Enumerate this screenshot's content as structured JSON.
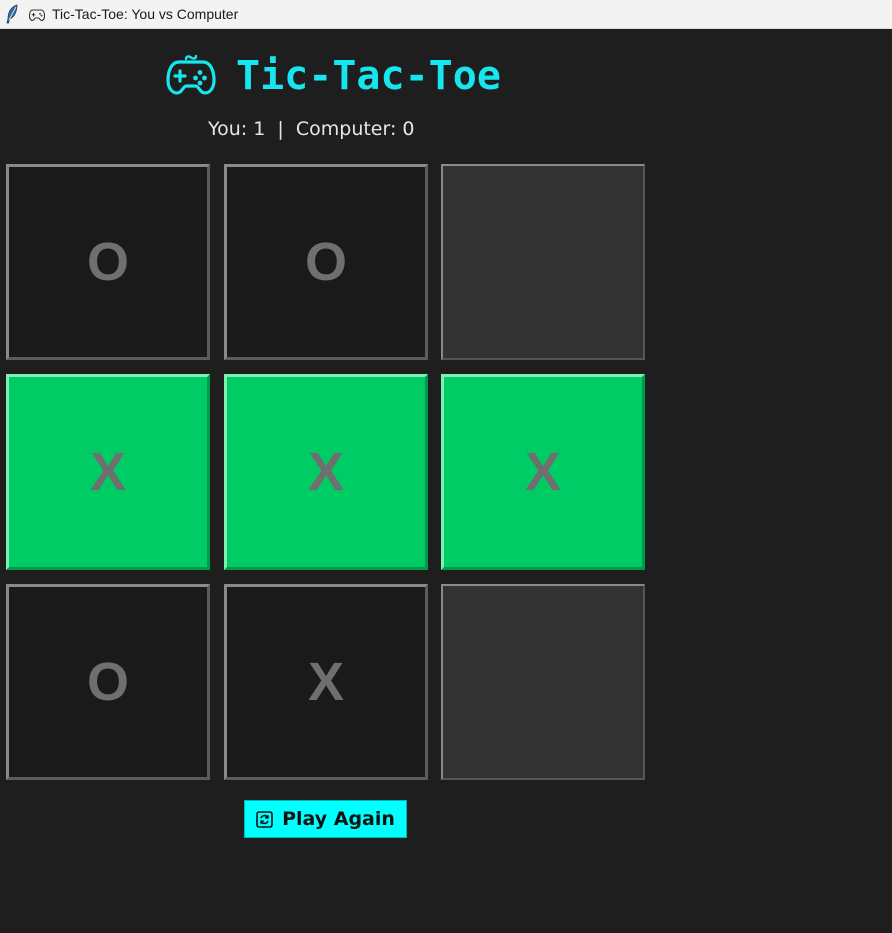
{
  "window": {
    "title": "Tic-Tac-Toe: You vs Computer"
  },
  "header": {
    "title": "Tic-Tac-Toe",
    "title_color": "#17e6ee",
    "icon": "gamepad-icon"
  },
  "score": {
    "you_label": "You: ",
    "you_value": "1",
    "separator": "  |  ",
    "computer_label": "Computer: ",
    "computer_value": "0"
  },
  "board": {
    "cells": [
      {
        "mark": "O",
        "state": "played"
      },
      {
        "mark": "O",
        "state": "played"
      },
      {
        "mark": "",
        "state": "empty"
      },
      {
        "mark": "X",
        "state": "win"
      },
      {
        "mark": "X",
        "state": "win"
      },
      {
        "mark": "X",
        "state": "win"
      },
      {
        "mark": "O",
        "state": "played"
      },
      {
        "mark": "X",
        "state": "played"
      },
      {
        "mark": "",
        "state": "empty"
      }
    ],
    "colors": {
      "win": "#00cc66",
      "played": "#1a1a1a",
      "empty": "#333333",
      "mark": "#6f6f6f"
    }
  },
  "controls": {
    "play_again_label": "Play Again",
    "play_again_color": "#00ffff",
    "icon": "refresh-icon"
  }
}
